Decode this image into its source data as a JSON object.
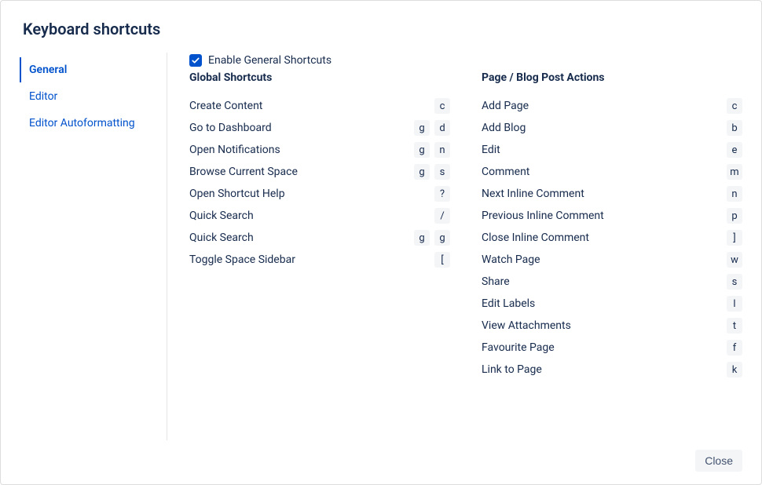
{
  "title": "Keyboard shortcuts",
  "sidebar": {
    "items": [
      {
        "label": "General",
        "name": "general",
        "active": true
      },
      {
        "label": "Editor",
        "name": "editor",
        "active": false
      },
      {
        "label": "Editor Autoformatting",
        "name": "editor-autoformatting",
        "active": false
      }
    ]
  },
  "enable": {
    "checked": true,
    "label": "Enable General Shortcuts"
  },
  "columns": [
    {
      "title": "Global Shortcuts",
      "rows": [
        {
          "label": "Create Content",
          "keys": [
            "c"
          ]
        },
        {
          "label": "Go to Dashboard",
          "keys": [
            "g",
            "d"
          ]
        },
        {
          "label": "Open Notifications",
          "keys": [
            "g",
            "n"
          ]
        },
        {
          "label": "Browse Current Space",
          "keys": [
            "g",
            "s"
          ]
        },
        {
          "label": "Open Shortcut Help",
          "keys": [
            "?"
          ]
        },
        {
          "label": "Quick Search",
          "keys": [
            "/"
          ]
        },
        {
          "label": "Quick Search",
          "keys": [
            "g",
            "g"
          ]
        },
        {
          "label": "Toggle Space Sidebar",
          "keys": [
            "["
          ]
        }
      ]
    },
    {
      "title": "Page / Blog Post Actions",
      "rows": [
        {
          "label": "Add Page",
          "keys": [
            "c"
          ]
        },
        {
          "label": "Add Blog",
          "keys": [
            "b"
          ]
        },
        {
          "label": "Edit",
          "keys": [
            "e"
          ]
        },
        {
          "label": "Comment",
          "keys": [
            "m"
          ]
        },
        {
          "label": "Next Inline Comment",
          "keys": [
            "n"
          ]
        },
        {
          "label": "Previous Inline Comment",
          "keys": [
            "p"
          ]
        },
        {
          "label": "Close Inline Comment",
          "keys": [
            "]"
          ]
        },
        {
          "label": "Watch Page",
          "keys": [
            "w"
          ]
        },
        {
          "label": "Share",
          "keys": [
            "s"
          ]
        },
        {
          "label": "Edit Labels",
          "keys": [
            "l"
          ]
        },
        {
          "label": "View Attachments",
          "keys": [
            "t"
          ]
        },
        {
          "label": "Favourite Page",
          "keys": [
            "f"
          ]
        },
        {
          "label": "Link to Page",
          "keys": [
            "k"
          ]
        }
      ]
    }
  ],
  "footer": {
    "close_label": "Close"
  }
}
